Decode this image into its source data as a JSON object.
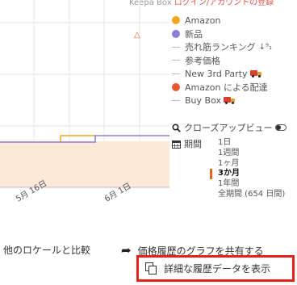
{
  "topline": {
    "left": "Keepa Box",
    "right": "ログイン/アカウントの登録"
  },
  "chart_data": {
    "type": "line",
    "x_tick_labels": [
      "5月 16日",
      "6月 1日"
    ],
    "series": [
      {
        "name": "Amazon",
        "color": "#f2a51c"
      },
      {
        "name": "新品",
        "color": "#8b7ed8"
      }
    ],
    "fill_color": "#fce9d8"
  },
  "legend": {
    "items": [
      {
        "label": "Amazon",
        "marker": "dot",
        "color": "#f2a51c"
      },
      {
        "label": "新品",
        "marker": "dot",
        "color": "#8b7ed8"
      },
      {
        "label": "売れ筋ランキング",
        "marker": "dash",
        "icon": "sort-icon"
      },
      {
        "label": "参考価格",
        "marker": "dash"
      },
      {
        "label": "New 3rd Party",
        "marker": "dash",
        "icon": "truck-icon"
      },
      {
        "label": "Amazon による配達",
        "marker": "dot",
        "color": "#e8582f"
      },
      {
        "label": "Buy Box",
        "marker": "dash",
        "icon": "truck-icon"
      }
    ]
  },
  "zoom": {
    "label": "クローズアップビュー"
  },
  "period": {
    "label": "期間",
    "options": [
      "1日",
      "1週間",
      "1ヶ月",
      "3か月",
      "1年間",
      "全期間 (654 日間)"
    ],
    "selected": "3か月"
  },
  "footer": {
    "compare": "他のロケールと比較",
    "share": "価格履歴のグラフを共有する",
    "detail": "詳細な履歴データを表示"
  }
}
